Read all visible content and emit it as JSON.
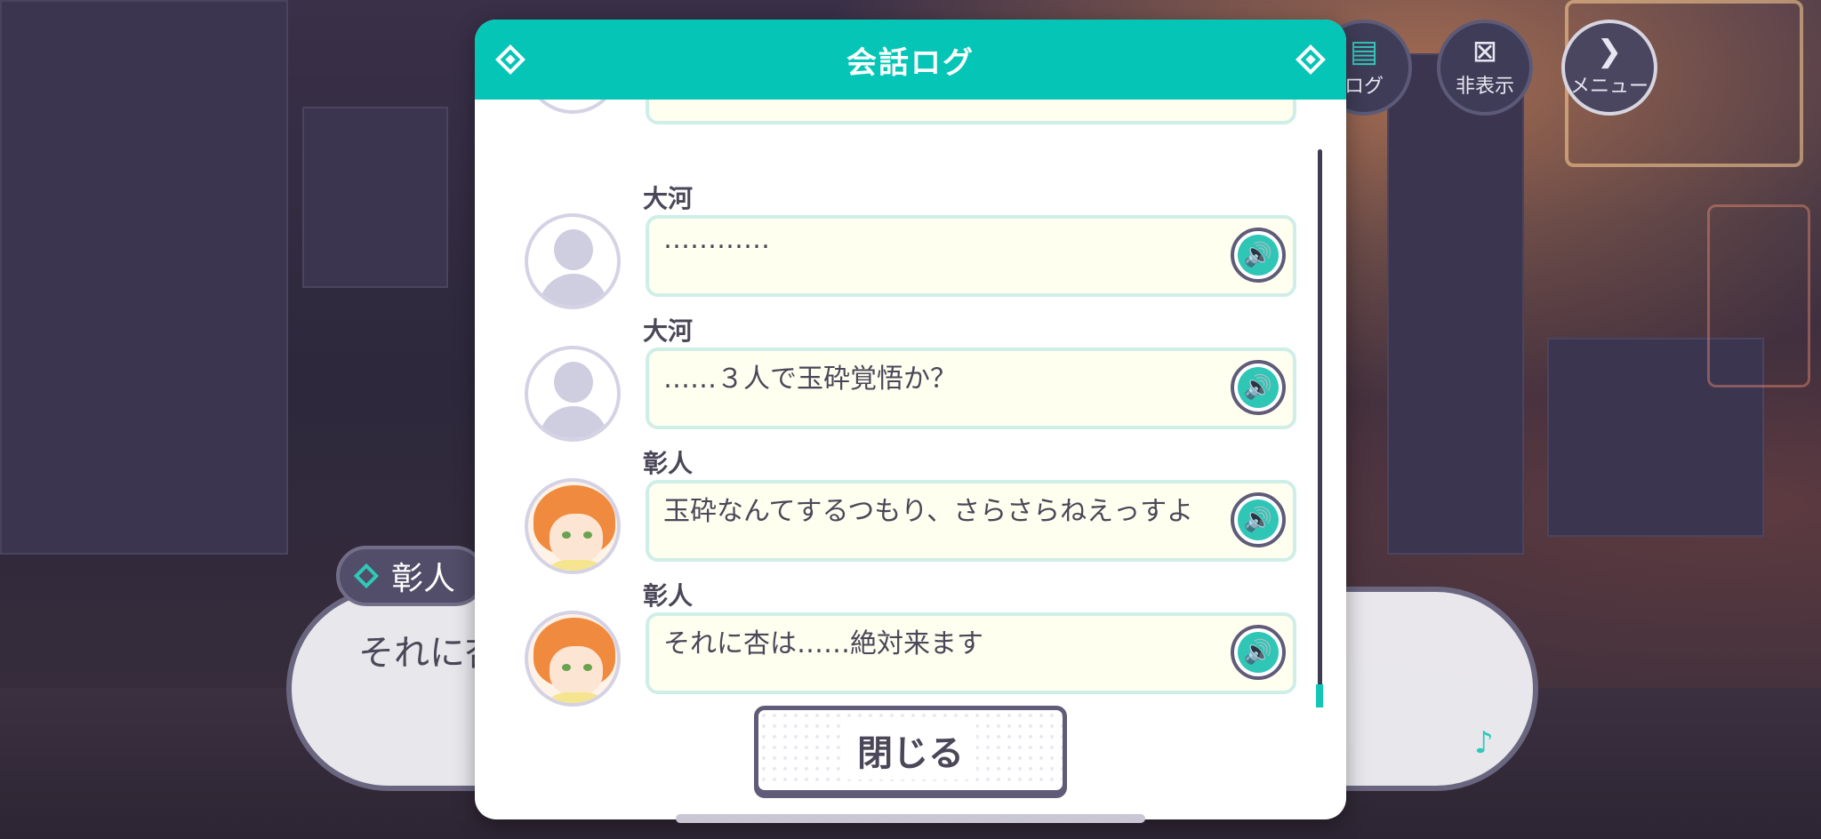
{
  "window": {
    "title": "会話ログ"
  },
  "controls": {
    "log_label": "ログ",
    "hide_label": "非表示",
    "menu_label": "メニュー"
  },
  "dialogue": {
    "speaker": "彰人",
    "text": "それに杏"
  },
  "log_entries": [
    {
      "speaker": "大河",
      "text": "…………",
      "avatar": "placeholder"
    },
    {
      "speaker": "大河",
      "text": "……３人で玉砕覚悟か？",
      "avatar": "placeholder"
    },
    {
      "speaker": "彰人",
      "text": "玉砕なんてするつもり、さらさらねえっすよ",
      "avatar": "akito"
    },
    {
      "speaker": "彰人",
      "text": "それに杏は……絶対来ます",
      "avatar": "akito"
    }
  ],
  "close_button": {
    "label": "閉じる"
  },
  "colors": {
    "accent": "#05c6b6",
    "text": "#4b4758",
    "bubble": "#fffff0"
  },
  "icons": {
    "voice": "speaker-icon",
    "log": "chat-log-icon",
    "hide": "hide-icon",
    "menu": "chevron-right-icon"
  }
}
